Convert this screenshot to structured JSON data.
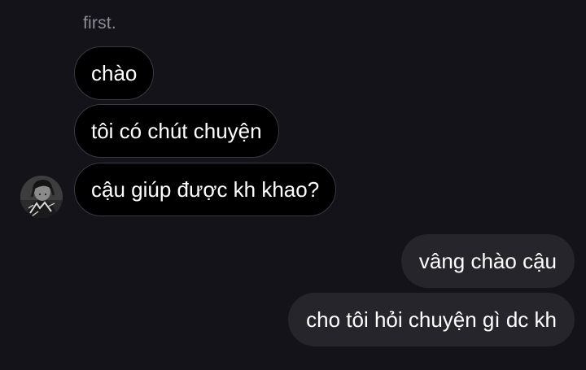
{
  "thread": {
    "sender_name": "first.",
    "incoming_messages": [
      "chào",
      "tôi có chút chuyện",
      "cậu giúp được kh khao?"
    ],
    "outgoing_messages": [
      "vâng chào cậu",
      "cho tôi hỏi chuyện gì dc kh"
    ],
    "avatar": "user-avatar-photo"
  },
  "colors": {
    "background": "#14131a",
    "incoming_bubble": "#000000",
    "incoming_border": "#3a3940",
    "outgoing_bubble": "#26252c",
    "sender_name": "#8e8d96",
    "text": "#ffffff"
  }
}
